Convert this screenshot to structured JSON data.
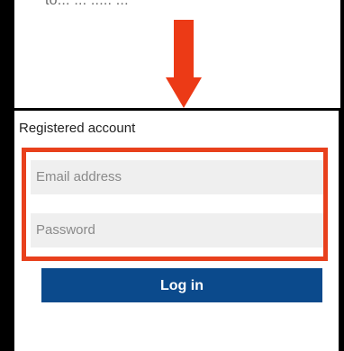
{
  "caption": {
    "text": "to... ... ..... ..."
  },
  "annotation": {
    "arrow_color": "#ec3a16",
    "highlight_color": "#e8401c"
  },
  "login": {
    "title": "Registered account",
    "email_placeholder": "Email address",
    "password_placeholder": "Password",
    "button_label": "Log in",
    "button_color": "#0b4a8c"
  }
}
